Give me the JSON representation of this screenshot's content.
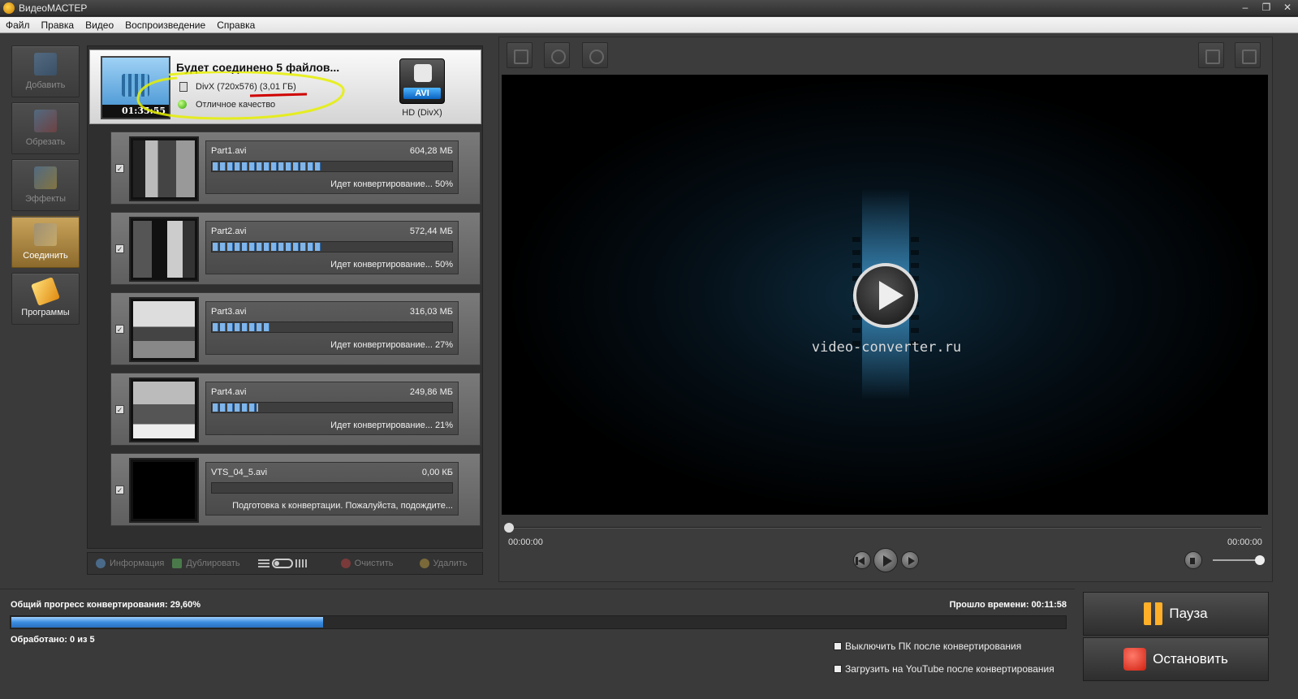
{
  "window": {
    "title": "ВидеоМАСТЕР",
    "controls": [
      "‒",
      "❐",
      "✕"
    ]
  },
  "menu": [
    "Файл",
    "Правка",
    "Видео",
    "Воспроизведение",
    "Справка"
  ],
  "sidebar": [
    {
      "label": "Добавить",
      "icon": "add-video-icon"
    },
    {
      "label": "Обрезать",
      "icon": "cut-video-icon"
    },
    {
      "label": "Эффекты",
      "icon": "effects-icon"
    },
    {
      "label": "Соединить",
      "icon": "join-icon"
    },
    {
      "label": "Программы",
      "icon": "programs-icon"
    }
  ],
  "merge": {
    "title": "Будет соединено 5 файлов...",
    "duration": "01:35:55",
    "format": "DivX (720x576) (3,01 ГБ)",
    "quality": "Отличное качество",
    "output_label": "AVI",
    "output_name": "HD (DivX)"
  },
  "files": [
    {
      "name": "Part1.avi",
      "size": "604,28 МБ",
      "status": "Идет конвертирование... 50%",
      "progress": 50
    },
    {
      "name": "Part2.avi",
      "size": "572,44 МБ",
      "status": "Идет конвертирование... 50%",
      "progress": 50
    },
    {
      "name": "Part3.avi",
      "size": "316,03 МБ",
      "status": "Идет конвертирование... 27%",
      "progress": 27
    },
    {
      "name": "Part4.avi",
      "size": "249,86 МБ",
      "status": "Идет конвертирование... 21%",
      "progress": 21
    },
    {
      "name": "VTS_04_5.avi",
      "size": "0,00 КБ",
      "status": "Подготовка к конвертации. Пожалуйста, подождите...",
      "progress": 0
    }
  ],
  "list_tools": {
    "info": "Информация",
    "duplicate": "Дублировать",
    "clear": "Очистить",
    "delete": "Удалить"
  },
  "player": {
    "watermark": "video-converter.ru",
    "time_start": "00:00:00",
    "time_end": "00:00:00",
    "seek_position": 0,
    "volume": 100
  },
  "conversion": {
    "total_label": "Общий прогресс конвертирования: 29,60%",
    "total_progress": 29.6,
    "elapsed_label": "Прошло времени: 00:11:58",
    "processed_label": "Обработано: 0 из 5",
    "opt_shutdown": "Выключить ПК после конвертирования",
    "opt_youtube": "Загрузить на YouTube после конвертирования"
  },
  "actions": {
    "pause": "Пауза",
    "stop": "Остановить"
  },
  "colors": {
    "accent_progress": "#3a8ce0",
    "active_tab": "#c9a45c",
    "highlight_marker": "#e6f000",
    "underline_marker": "#d00000"
  }
}
